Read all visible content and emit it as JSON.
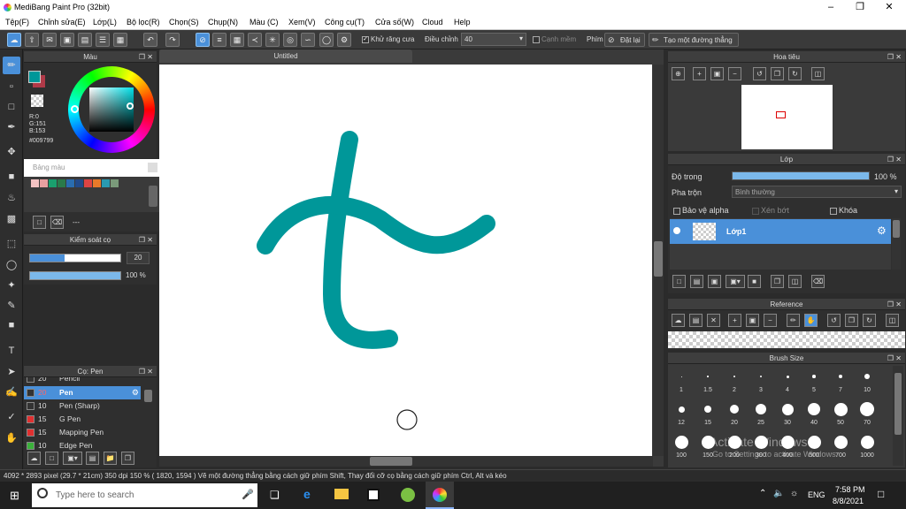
{
  "app": {
    "title": "MediBang Paint Pro (32bit)"
  },
  "menu": [
    "Tệp(F)",
    "Chỉnh sửa(E)",
    "Lớp(L)",
    "Bộ lọc(R)",
    "Chọn(S)",
    "Chụp(N)",
    "Màu (C)",
    "Xem(V)",
    "Công cụ(T)",
    "Cửa số(W)",
    "Cloud",
    "Help"
  ],
  "toolbar": {
    "antialias_label": "Khử răng cưa",
    "adjust_label": "Điều chỉnh",
    "adjust_value": "40",
    "edge_label": "Cạnh mềm",
    "key_label": "Phím",
    "reset_label": "Đặt lại",
    "create_line_label": "Tạo một đường thẳng"
  },
  "color_panel": {
    "title": "Màu",
    "r": "R:0",
    "g": "G:151",
    "b": "B:153",
    "hex": "#009799",
    "primary_color": "#009799",
    "secondary_color": "#b03a48",
    "palette_title": "Bảng màu",
    "palette_footer": "---"
  },
  "brush_control": {
    "title": "Kiểm soát cọ",
    "size_value": "20",
    "size_fraction": 0.38,
    "opacity_value": "100 %",
    "opacity_fraction": 1.0
  },
  "brush_list": {
    "title": "Cọ: Pen",
    "items": [
      {
        "size": "20",
        "name": "Pencil",
        "color": "#333333"
      },
      {
        "size": "20",
        "name": "Pen",
        "color": "#333333",
        "selected": true
      },
      {
        "size": "10",
        "name": "Pen (Sharp)",
        "color": "#333333"
      },
      {
        "size": "15",
        "name": "G Pen",
        "color": "#e03030"
      },
      {
        "size": "15",
        "name": "Mapping Pen",
        "color": "#e03030"
      },
      {
        "size": "10",
        "name": "Edge Pen",
        "color": "#3bb03b"
      }
    ]
  },
  "document": {
    "tab_title": "Untitled"
  },
  "navigator": {
    "title": "Hoa tiêu"
  },
  "layer_panel": {
    "title": "Lớp",
    "opacity_label": "Độ trong",
    "opacity_value": "100 %",
    "blend_label": "Pha trộn",
    "blend_value": "Bình thường",
    "protect_alpha": "Bảo vệ alpha",
    "clipping": "Xén bớt",
    "lock": "Khóa",
    "layer_name": "Lớp1"
  },
  "reference": {
    "title": "Reference"
  },
  "brush_size": {
    "title": "Brush Size",
    "sizes": [
      "1",
      "1.5",
      "2",
      "3",
      "4",
      "5",
      "7",
      "10",
      "12",
      "15",
      "20",
      "25",
      "30",
      "40",
      "50",
      "70",
      "100",
      "150",
      "200",
      "300",
      "400",
      "500",
      "700",
      "1000"
    ]
  },
  "watermark": {
    "line1": "Activate Windows",
    "line2": "Go to Settings to activate Windows."
  },
  "status": {
    "text": "4092 * 2893 pixel   (29.7 * 21cm)   350 dpi   150 %   ( 1820, 1594 )   Vẽ một đường thẳng bằng cách giữ phím Shift, Thay đổi cỡ cọ bằng cách giữ phím Ctrl, Alt và kéo"
  },
  "taskbar": {
    "search_placeholder": "Type here to search",
    "lang": "ENG",
    "time": "7:58 PM",
    "date": "8/8/2021"
  }
}
